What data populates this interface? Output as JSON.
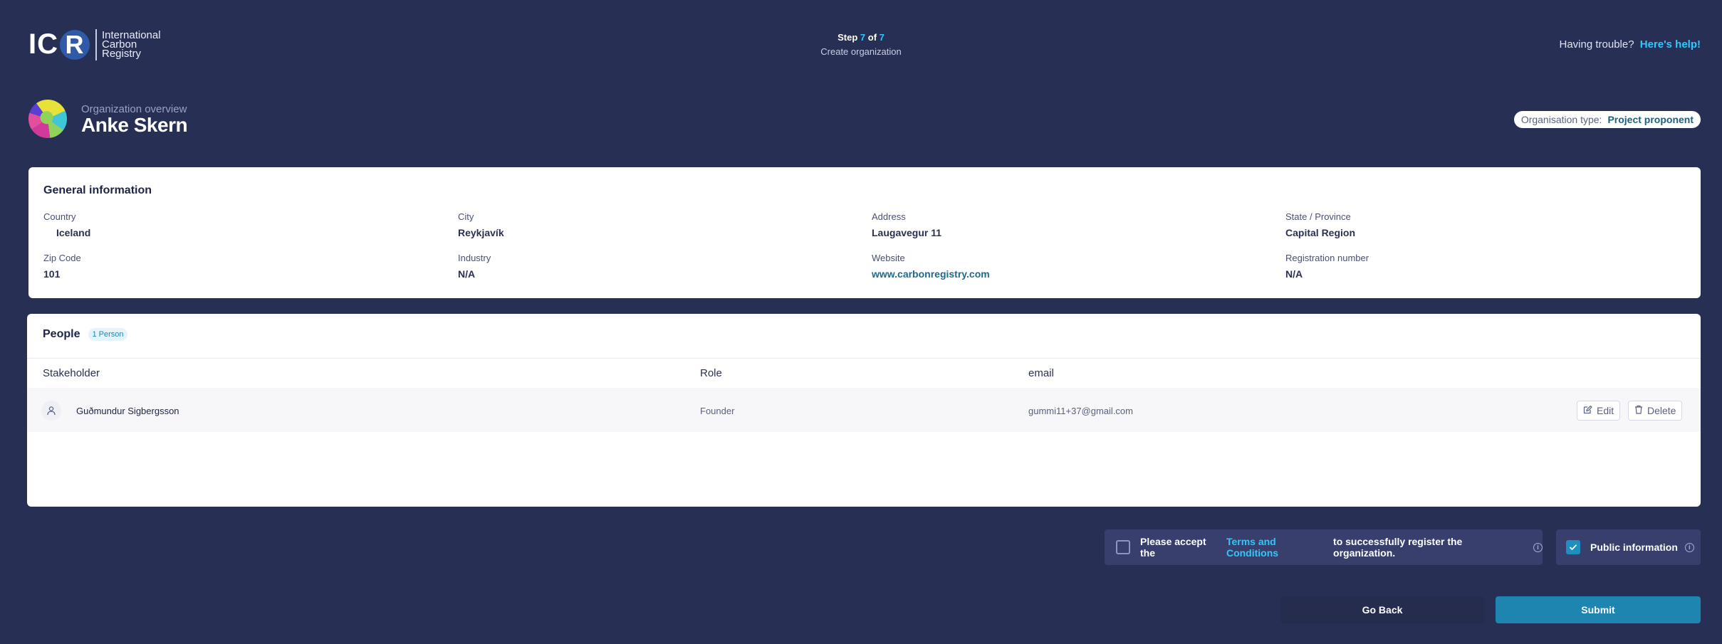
{
  "header": {
    "logo_letters_prefix": "IC",
    "logo_letters_circle": "R",
    "logo_lines": [
      "International",
      "Carbon",
      "Registry"
    ],
    "step_word": "Step",
    "step_current": "7",
    "step_of": "of",
    "step_total": "7",
    "step_title": "Create organization",
    "help_question": "Having trouble?",
    "help_link": "Here's help!"
  },
  "organization": {
    "overview_label": "Organization overview",
    "name": "Anke Skern",
    "type_label": "Organisation type:",
    "type_value": "Project proponent"
  },
  "general": {
    "title": "General information",
    "fields": [
      {
        "label": "Country",
        "value": "Iceland"
      },
      {
        "label": "City",
        "value": "Reykjavík"
      },
      {
        "label": "Address",
        "value": "Laugavegur 11"
      },
      {
        "label": "State / Province",
        "value": "Capital Region"
      },
      {
        "label": "Zip Code",
        "value": "101"
      },
      {
        "label": "Industry",
        "value": "N/A"
      },
      {
        "label": "Website",
        "value": "www.carbonregistry.com"
      },
      {
        "label": "Registration number",
        "value": "N/A"
      }
    ]
  },
  "people": {
    "title": "People",
    "count_badge": "1 Person",
    "columns": [
      "Stakeholder",
      "Role",
      "email"
    ],
    "rows": [
      {
        "name": "Guðmundur Sigbergsson",
        "role": "Founder",
        "email": "gummi11+37@gmail.com",
        "edit_label": "Edit",
        "delete_label": "Delete"
      }
    ]
  },
  "footer": {
    "terms_prefix": "Please accept the",
    "terms_link": "Terms and Conditions",
    "terms_suffix": "to successfully register the organization.",
    "terms_checked": false,
    "public_label": "Public information",
    "public_checked": true,
    "back_label": "Go Back",
    "submit_label": "Submit"
  },
  "colors": {
    "background": "#282f55",
    "accent": "#2ec8ff",
    "submit": "#1e85b0"
  }
}
